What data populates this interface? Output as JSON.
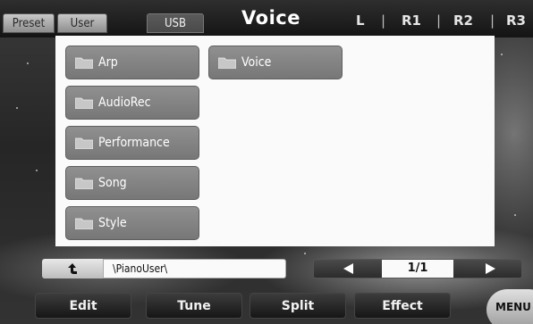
{
  "header": {
    "tabs": [
      {
        "label": "Preset",
        "active": false
      },
      {
        "label": "User",
        "active": false
      },
      {
        "label": "USB",
        "active": true
      }
    ],
    "title": "Voice",
    "parts": [
      "L",
      "R1",
      "R2",
      "R3"
    ],
    "separator": "|"
  },
  "folders": {
    "column1": [
      "Arp",
      "AudioRec",
      "Performance",
      "Song",
      "Style"
    ],
    "column2": [
      "Voice"
    ]
  },
  "path_bar": {
    "path": "\\PianoUser\\",
    "page": "1/1"
  },
  "bottom_menu": {
    "buttons": [
      "Edit",
      "Tune",
      "Split",
      "Effect"
    ],
    "menu_label": "MENU"
  },
  "colors": {
    "panel_bg": "#fafafa",
    "folder_bg": "#808080",
    "header_bg": "#141414"
  }
}
